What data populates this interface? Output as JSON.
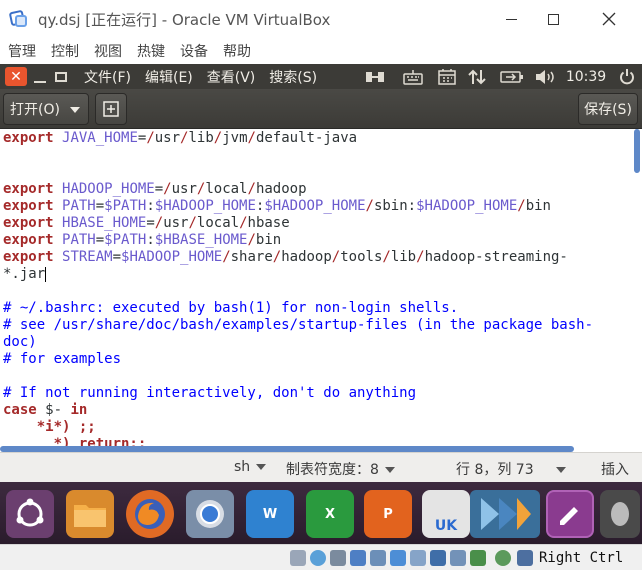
{
  "window": {
    "title": "qy.dsj [正在运行] - Oracle VM VirtualBox",
    "menu": [
      "管理",
      "控制",
      "视图",
      "热键",
      "设备",
      "帮助"
    ]
  },
  "panel": {
    "menus": [
      "文件(F)",
      "编辑(E)",
      "查看(V)",
      "搜索(S)"
    ],
    "close_glyph": "✕",
    "clock": "10:39",
    "indicators": [
      "network-icon",
      "keyboard-icon",
      "calendar-icon",
      "transfer-icon",
      "battery-icon",
      "volume-icon",
      "power-icon"
    ]
  },
  "toolbar": {
    "open_label": "打开(O)",
    "save_label": "保存(S)"
  },
  "editor": {
    "lines": [
      [
        [
          "kw",
          "export"
        ],
        [
          "t",
          " "
        ],
        [
          "var",
          "JAVA_HOME"
        ],
        [
          "t",
          "="
        ],
        [
          "sl",
          "/"
        ],
        [
          "t",
          "usr"
        ],
        [
          "sl",
          "/"
        ],
        [
          "t",
          "lib"
        ],
        [
          "sl",
          "/"
        ],
        [
          "t",
          "jvm"
        ],
        [
          "sl",
          "/"
        ],
        [
          "t",
          "default-java"
        ]
      ],
      [],
      [],
      [
        [
          "kw",
          "export"
        ],
        [
          "t",
          " "
        ],
        [
          "var",
          "HADOOP_HOME"
        ],
        [
          "t",
          "="
        ],
        [
          "sl",
          "/"
        ],
        [
          "t",
          "usr"
        ],
        [
          "sl",
          "/"
        ],
        [
          "t",
          "local"
        ],
        [
          "sl",
          "/"
        ],
        [
          "t",
          "hadoop"
        ]
      ],
      [
        [
          "kw",
          "export"
        ],
        [
          "t",
          " "
        ],
        [
          "var",
          "PATH"
        ],
        [
          "t",
          "="
        ],
        [
          "var",
          "$PATH"
        ],
        [
          "t",
          ":"
        ],
        [
          "var",
          "$HADOOP_HOME"
        ],
        [
          "t",
          ":"
        ],
        [
          "var",
          "$HADOOP_HOME"
        ],
        [
          "sl",
          "/"
        ],
        [
          "t",
          "sbin:"
        ],
        [
          "var",
          "$HADOOP_HOME"
        ],
        [
          "sl",
          "/"
        ],
        [
          "t",
          "bin"
        ]
      ],
      [
        [
          "kw",
          "export"
        ],
        [
          "t",
          " "
        ],
        [
          "var",
          "HBASE_HOME"
        ],
        [
          "t",
          "="
        ],
        [
          "sl",
          "/"
        ],
        [
          "t",
          "usr"
        ],
        [
          "sl",
          "/"
        ],
        [
          "t",
          "local"
        ],
        [
          "sl",
          "/"
        ],
        [
          "t",
          "hbase"
        ]
      ],
      [
        [
          "kw",
          "export"
        ],
        [
          "t",
          " "
        ],
        [
          "var",
          "PATH"
        ],
        [
          "t",
          "="
        ],
        [
          "var",
          "$PATH"
        ],
        [
          "t",
          ":"
        ],
        [
          "var",
          "$HBASE_HOME"
        ],
        [
          "sl",
          "/"
        ],
        [
          "t",
          "bin"
        ]
      ],
      [
        [
          "kw",
          "export"
        ],
        [
          "t",
          " "
        ],
        [
          "var",
          "STREAM"
        ],
        [
          "t",
          "="
        ],
        [
          "var",
          "$HADOOP_HOME"
        ],
        [
          "sl",
          "/"
        ],
        [
          "t",
          "share"
        ],
        [
          "sl",
          "/"
        ],
        [
          "t",
          "hadoop"
        ],
        [
          "sl",
          "/"
        ],
        [
          "t",
          "tools"
        ],
        [
          "sl",
          "/"
        ],
        [
          "t",
          "lib"
        ],
        [
          "sl",
          "/"
        ],
        [
          "t",
          "hadoop-streaming-"
        ]
      ],
      [
        [
          "t",
          "*.jar"
        ],
        [
          "cursor",
          ""
        ]
      ],
      [],
      [
        [
          "cm",
          "# ~/.bashrc: executed by bash(1) for non-login shells."
        ]
      ],
      [
        [
          "cm",
          "# see /usr/share/doc/bash/examples/startup-files (in the package bash-"
        ]
      ],
      [
        [
          "cm",
          "doc)"
        ]
      ],
      [
        [
          "cm",
          "# for examples"
        ]
      ],
      [],
      [
        [
          "cm",
          "# If not running interactively, don't do anything"
        ]
      ],
      [
        [
          "kw",
          "case"
        ],
        [
          "t",
          " $- "
        ],
        [
          "kw",
          "in"
        ]
      ],
      [
        [
          "t",
          "    "
        ],
        [
          "kw",
          "*i*) ;;"
        ]
      ],
      [
        [
          "t",
          "      "
        ],
        [
          "kw",
          "*) return;;"
        ]
      ]
    ]
  },
  "statusbar": {
    "language": "sh",
    "tab_width": "制表符宽度：8",
    "position": "行 8，列 73",
    "mode": "插入"
  },
  "dock": {
    "writer_letter": "W",
    "calc_letter": "X",
    "impress_letter": "P",
    "uk_label": "UK"
  },
  "vbox_status": {
    "host_key": "Right Ctrl"
  }
}
